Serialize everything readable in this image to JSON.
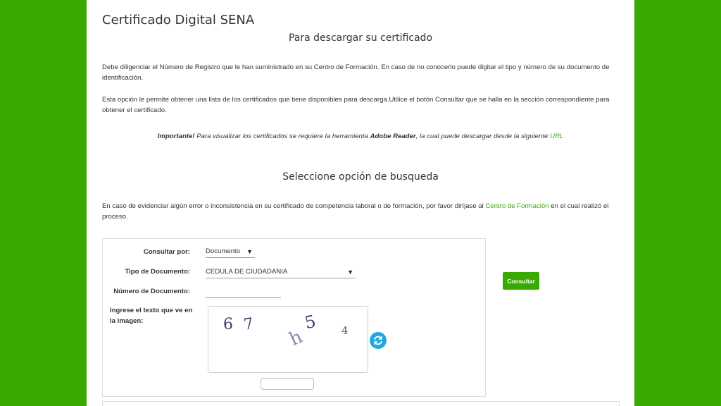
{
  "header": {
    "title": "Certificado Digital SENA",
    "subtitle": "Para descargar su certificado"
  },
  "intro": {
    "paragraph1": "Debe diligenciar el Número de Registro que le han suministrado en su Centro de Formación. En caso de no conocerlo puede digitar el tipo y número de su documento de identificación.",
    "paragraph2": "Esta opción le permite obtener una lista de los certificados que tiene disponibles para descarga.Utilice el botón Consultar que se halla en la sección correspondiente para obtener el certificado.",
    "note_bold": "Importante!",
    "note_text1": " Para visualizar los certificados se requiere la herramienta ",
    "note_bold2": "Adobe Reader",
    "note_text2": ", la cual puede descargar desde la siguiente ",
    "note_link": "URL"
  },
  "search": {
    "heading": "Seleccione opción de busqueda",
    "error_text1": "En caso de evidenciar algún error o inconsistencia en su certificado de competencia laboral o de formación, por favor diríjase al ",
    "error_link": "Centro de Formación",
    "error_text2": " en el cual realizó el proceso."
  },
  "form": {
    "consultar_por_label": "Consultar por:",
    "consultar_por_value": "Documento",
    "tipo_documento_label": "Tipo de Documento:",
    "tipo_documento_value": "CEDULA DE CIUDADANIA",
    "numero_documento_label": "Número de Documento:",
    "numero_documento_value": "",
    "captcha_label": "Ingrese el texto que ve en la imagen:",
    "captcha_chars": [
      "6",
      "7",
      "h",
      "5",
      "4"
    ],
    "captcha_input_value": "",
    "consultar_button": "Consultar"
  },
  "colors": {
    "brand_green": "#39aa00",
    "refresh_blue": "#22a8e0",
    "captcha_ink": "#3a3f6b",
    "captcha_purple": "#8a3c8f"
  },
  "icons": {
    "dropdown": "caret-down-icon",
    "refresh": "refresh-icon"
  }
}
